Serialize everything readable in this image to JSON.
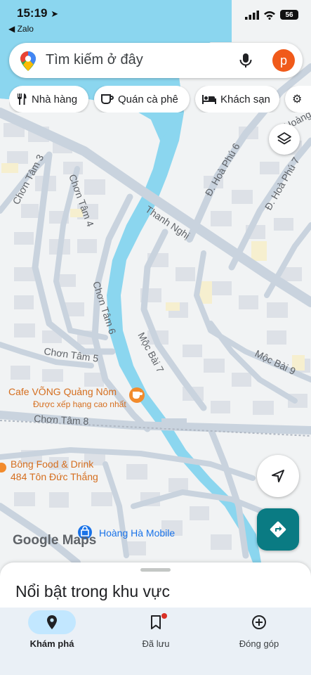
{
  "status_bar": {
    "time": "15:19",
    "back_app": "◀ Zalo",
    "battery": "56"
  },
  "search": {
    "placeholder": "Tìm kiếm ở đây",
    "avatar_letter": "p"
  },
  "chips": [
    {
      "label": "Nhà hàng",
      "icon": "restaurant-icon"
    },
    {
      "label": "Quán cà phê",
      "icon": "coffee-icon"
    },
    {
      "label": "Khách sạn",
      "icon": "hotel-icon"
    }
  ],
  "map": {
    "streets": {
      "thanh_nghi": "Thanh Nghị",
      "chon_tam_3": "Chơn Tâm 3",
      "chon_tam_4": "Chơn Tâm 4",
      "chon_tam_6": "Chơn Tâm 6",
      "chon_tam_5": "Chơn Tâm 5",
      "chon_tam_8": "Chơn Tâm 8",
      "moc_bai_7": "Mộc Bài 7",
      "moc_bai_9": "Mộc Bài 9",
      "hoa_phu_6": "Đ. Hoà Phú 6",
      "hoa_phu_7": "Đ. Hoà Phú 7",
      "hoang": "Hoàng"
    },
    "pois": {
      "cafe_name": "Cafe VÕNG Quảng Nôm",
      "cafe_sub": "Được xếp hạng cao nhất",
      "food_name": "Bông Food & Drink",
      "food_address": "484 Tôn Đức Thắng",
      "mobile_name": "Hoàng Hà Mobile"
    },
    "logo": "Google Maps"
  },
  "sheet": {
    "title": "Nổi bật trong khu vực"
  },
  "nav": [
    {
      "label": "Khám phá",
      "icon": "explore-pin-icon",
      "active": true
    },
    {
      "label": "Đã lưu",
      "icon": "bookmark-icon",
      "active": false
    },
    {
      "label": "Đóng góp",
      "icon": "add-circle-icon",
      "active": false
    }
  ],
  "colors": {
    "water": "#8bd6ef",
    "road": "#c9d3de",
    "building": "#dde1e7",
    "poi_orange": "#d56e1e",
    "directions_teal": "#0a7b83",
    "avatar": "#f05a1a"
  }
}
